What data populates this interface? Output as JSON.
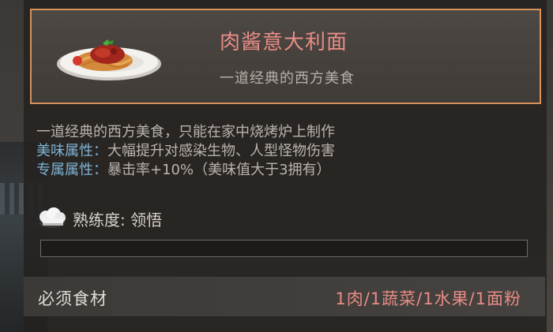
{
  "dish": {
    "name": "肉酱意大利面",
    "subtitle": "一道经典的西方美食"
  },
  "description": {
    "line1": "一道经典的西方美食，只能在家中烧烤炉上制作",
    "flavor_label": "美味属性：",
    "flavor_text": "大幅提升对感染生物、人型怪物伤害",
    "exclusive_label": "专属属性：",
    "exclusive_text": "暴击率+10%（美味值大于3拥有）"
  },
  "mastery": {
    "text": "熟练度: 领悟",
    "icon": "chef-hat-icon",
    "progress": 0
  },
  "ingredients": {
    "label": "必须食材",
    "value": "1肉/1蔬菜/1水果/1面粉"
  },
  "colors": {
    "accent_border": "#d8925a",
    "title_pink": "#e98c86",
    "attribute_blue": "#7fb4d6"
  }
}
